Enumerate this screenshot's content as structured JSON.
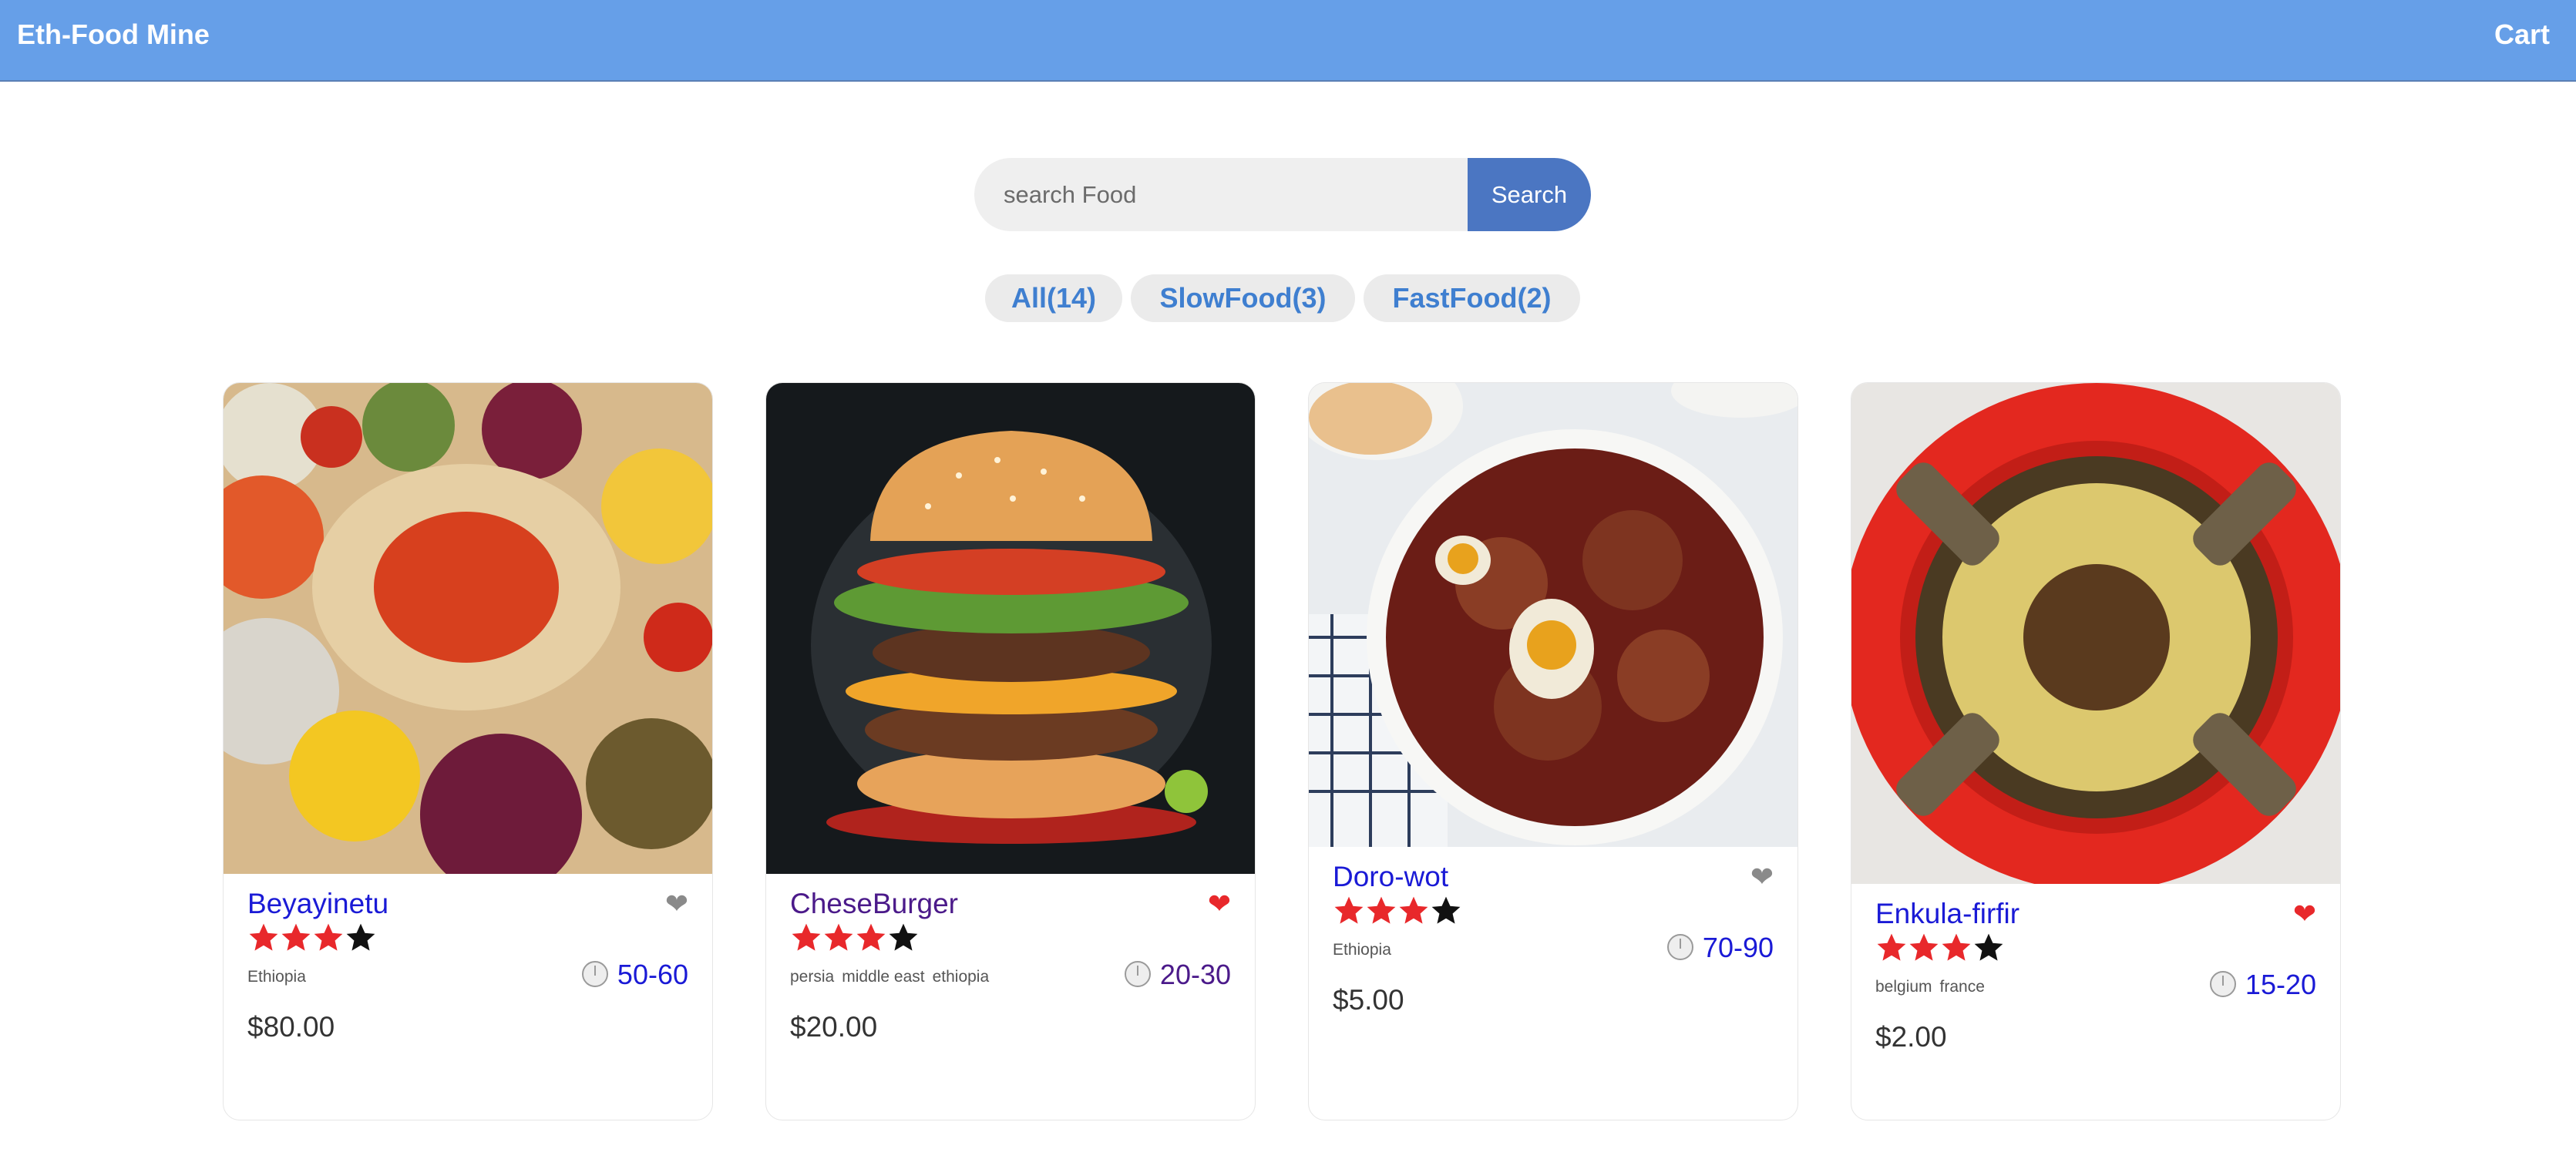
{
  "header": {
    "brand": "Eth-Food Mine",
    "cart": "Cart"
  },
  "search": {
    "placeholder": "search Food",
    "button": "Search"
  },
  "tags": [
    "All(14)",
    "SlowFood(3)",
    "FastFood(2)"
  ],
  "colors": {
    "header_bg": "#669fe8",
    "search_button": "#4b76c2",
    "tag_text": "#3f7fd0",
    "star": "#e8282b",
    "favorite_on": "#e8282b",
    "favorite_off": "#8a8a8a"
  },
  "foods": [
    {
      "name": "Beyayinetu",
      "rating": 3,
      "max_rating": 4,
      "favorite": false,
      "origins": [
        "Ethiopia"
      ],
      "cook_time": "50-60",
      "price": "$80.00"
    },
    {
      "name": "CheseBurger",
      "rating": 3,
      "max_rating": 4,
      "favorite": true,
      "origins": [
        "persia",
        "middle east",
        "ethiopia"
      ],
      "cook_time": "20-30",
      "price": "$20.00"
    },
    {
      "name": "Doro-wot",
      "rating": 3,
      "max_rating": 4,
      "favorite": false,
      "origins": [
        "Ethiopia"
      ],
      "cook_time": "70-90",
      "price": "$5.00"
    },
    {
      "name": "Enkula-firfir",
      "rating": 3,
      "max_rating": 4,
      "favorite": true,
      "origins": [
        "belgium",
        "france"
      ],
      "cook_time": "15-20",
      "price": "$2.00"
    }
  ]
}
